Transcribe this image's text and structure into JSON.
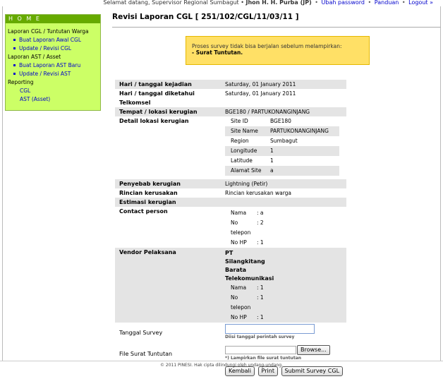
{
  "topbar": {
    "greeting": "Selamat datang, Supervisor Regional Sumbagut •",
    "user": "Jhon H. H. Purba (JP)",
    "links": [
      "Ubah password",
      "Panduan",
      "Logout »"
    ],
    "sep": "•"
  },
  "sidebar": {
    "home": "H O M E",
    "section1": "Laporan CGL / Tuntutan Warga",
    "section1_links": [
      "Buat Laporan Awal CGL",
      "Update / Revisi CGL"
    ],
    "section2": "Laporan AST / Asset",
    "section2_links": [
      "Buat Laporan AST Baru",
      "Update / Revisi AST"
    ],
    "section3": "Reporting",
    "section3_links": [
      "CGL",
      "AST (Asset)"
    ]
  },
  "page": {
    "title": "Revisi Laporan CGL [ 251/102/CGL/11/03/11 ]",
    "alert_line1": "Proses survey tidak bisa berjalan sebelum melampirkan:",
    "alert_line2": "- Surat Tuntutan."
  },
  "form": {
    "hari_label": "Hari / tanggal kejadian",
    "hari_value": "Saturday, 01 January 2011",
    "diketahui_label": "Hari / tanggal diketahui Telkomsel",
    "diketahui_value": "Saturday, 01 January 2011",
    "tempat_label": "Tempat / lokasi kerugian",
    "tempat_value": "BGE180 / PARTUKONANGINJANG",
    "detail_label": "Detail lokasi kerugian",
    "detail_rows": [
      {
        "k": "Site ID",
        "v": "BGE180"
      },
      {
        "k": "Site Name",
        "v": "PARTUKONANGINJANG"
      },
      {
        "k": "Region",
        "v": "Sumbagut"
      },
      {
        "k": "Longitude",
        "v": "1"
      },
      {
        "k": "Latitude",
        "v": "1"
      },
      {
        "k": "Alamat Site",
        "v": "a"
      }
    ],
    "penyebab_label": "Penyebab kerugian",
    "penyebab_value": "Lightning (Petir)",
    "rincian_label": "Rincian kerusakan",
    "rincian_value": "Rincian kerusakan warga",
    "estimasi_label": "Estimasi kerugian",
    "contact_label": "Contact person",
    "contact_rows": [
      {
        "k": "Nama",
        "v": ": a"
      },
      {
        "k": "No telepon",
        "v": ": 2"
      },
      {
        "k": "No HP",
        "v": ": 1"
      }
    ],
    "vendor_label": "Vendor Pelaksana",
    "vendor_name": [
      "PT",
      "Silangkitang",
      "Barata",
      "Telekomunikasi"
    ],
    "vendor_rows": [
      {
        "k": "Nama",
        "v": ": 1"
      },
      {
        "k": "No telepon",
        "v": ": 1"
      },
      {
        "k": "No HP",
        "v": ": 1"
      }
    ],
    "survey_label": "Tanggal Survey",
    "survey_value": "",
    "survey_hint": "Diisi tanggal perintah survey",
    "file_label": "File Surat Tuntutan",
    "browse_label": "Browse...",
    "file_hint": "*) Lampirkan file surat tuntutan",
    "btn_back": "Kembali",
    "btn_print": "Print",
    "btn_submit": "Submit Survey CGL"
  },
  "footer": {
    "text": "© 2011 PINESI. Hak cipta dilindungi oleh undang-undang."
  }
}
